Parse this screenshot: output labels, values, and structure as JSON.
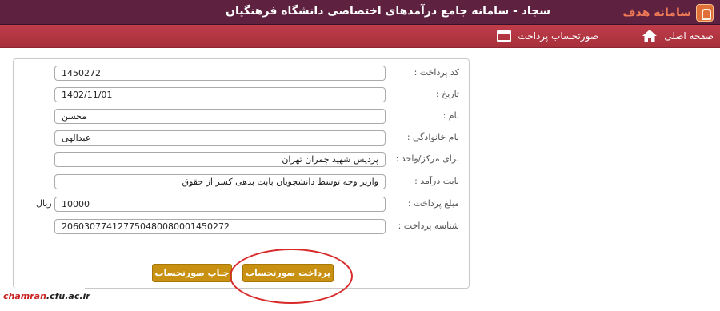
{
  "header": {
    "brand": "سامانه هدف",
    "title": "سجاد - سامانه جامع درآمدهای اختصاصی دانشگاه فرهنگیان"
  },
  "nav": {
    "home": "صفحه اصلی",
    "invoice": "صورتحساب پرداخت"
  },
  "form": {
    "payment_code": {
      "label": "کد پرداخت :",
      "value": "1450272"
    },
    "date": {
      "label": "تاریخ :",
      "value": "1402/11/01"
    },
    "first_name": {
      "label": "نام :",
      "value": "محسن"
    },
    "last_name": {
      "label": "نام خانوادگی :",
      "value": "عبدالهی"
    },
    "center": {
      "label": "برای مرکز/واحد :",
      "value": "پردیس شهید چمران تهران"
    },
    "income_type": {
      "label": "بابت درآمد :",
      "value": "واریز وجه توسط دانشجویان بابت بدهی کسر از حقوق"
    },
    "amount": {
      "label": "مبلغ پرداخت :",
      "value": "10000",
      "unit": "ریال"
    },
    "payment_id": {
      "label": "شناسه پرداخت :",
      "value": "206030774127750480080001450272"
    }
  },
  "buttons": {
    "pay": "پرداخت صورتحساب",
    "print": "چـاپ صورتحساب"
  },
  "watermark": {
    "part1": "chamran",
    "part2": ".cfu.ac.ir"
  },
  "colors": {
    "topbar": "#5e2140",
    "navbar": "#b3343f",
    "button": "#c99112",
    "highlight_circle": "#d92a2a"
  }
}
